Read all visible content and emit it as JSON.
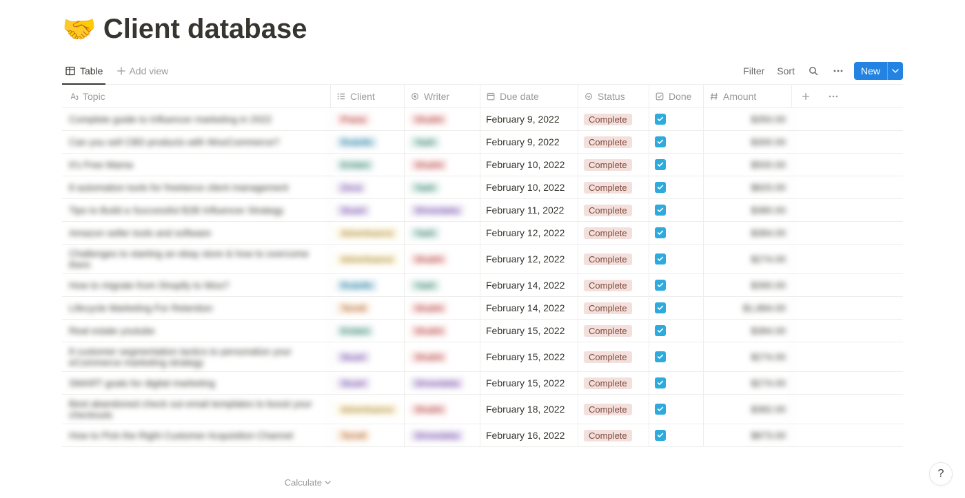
{
  "page": {
    "emoji": "🤝",
    "title": "Client database"
  },
  "views": {
    "active": "Table",
    "add_view_label": "Add view"
  },
  "toolbar": {
    "filter": "Filter",
    "sort": "Sort",
    "new": "New"
  },
  "columns": {
    "topic": "Topic",
    "client": "Client",
    "writer": "Writer",
    "due_date": "Due date",
    "status": "Status",
    "done": "Done",
    "amount": "Amount"
  },
  "rows": [
    {
      "topic": "Complete guide to Influencer marketing in 2022",
      "client": {
        "text": "Prana",
        "color": "red"
      },
      "writer": {
        "text": "Shubhi",
        "color": "red"
      },
      "date": "February 9, 2022",
      "status": "Complete",
      "done": true,
      "amount": "$350.00"
    },
    {
      "topic": "Can you sell CBD products with WooCommerce?",
      "client": {
        "text": "Rodolfo",
        "color": "blue"
      },
      "writer": {
        "text": "Yash",
        "color": "green"
      },
      "date": "February 9, 2022",
      "status": "Complete",
      "done": true,
      "amount": "$300.00"
    },
    {
      "topic": "It's Free Mama",
      "client": {
        "text": "Kristen",
        "color": "green"
      },
      "writer": {
        "text": "Shubhi",
        "color": "red"
      },
      "date": "February 10, 2022",
      "status": "Complete",
      "done": true,
      "amount": "$500.00"
    },
    {
      "topic": "8 automation tools for freelance client management",
      "client": {
        "text": "Zeca",
        "color": "purple"
      },
      "writer": {
        "text": "Yash",
        "color": "green"
      },
      "date": "February 10, 2022",
      "status": "Complete",
      "done": true,
      "amount": "$820.00"
    },
    {
      "topic": "Tips to Build a Successful B2B Influencer Strategy",
      "client": {
        "text": "Stuart",
        "color": "purple"
      },
      "writer": {
        "text": "Shreedatta",
        "color": "purple"
      },
      "date": "February 11, 2022",
      "status": "Complete",
      "done": true,
      "amount": "$380.00"
    },
    {
      "topic": "Amazon seller tools and software",
      "client": {
        "text": "Advertisance",
        "color": "yellow"
      },
      "writer": {
        "text": "Yash",
        "color": "green"
      },
      "date": "February 12, 2022",
      "status": "Complete",
      "done": true,
      "amount": "$384.00"
    },
    {
      "topic": "Challenges to starting an ebay store & how to overcome them",
      "client": {
        "text": "Advertisance",
        "color": "yellow"
      },
      "writer": {
        "text": "Shubhi",
        "color": "red"
      },
      "date": "February 12, 2022",
      "status": "Complete",
      "done": true,
      "amount": "$274.00"
    },
    {
      "topic": "How to migrate from Shopify to Woo?",
      "client": {
        "text": "Rodolfo",
        "color": "blue"
      },
      "writer": {
        "text": "Yash",
        "color": "green"
      },
      "date": "February 14, 2022",
      "status": "Complete",
      "done": true,
      "amount": "$390.00"
    },
    {
      "topic": "Lifecycle Marketing For Retention",
      "client": {
        "text": "Terrell",
        "color": "orange"
      },
      "writer": {
        "text": "Shubhi",
        "color": "red"
      },
      "date": "February 14, 2022",
      "status": "Complete",
      "done": true,
      "amount": "$1,884.00"
    },
    {
      "topic": "Real estate youtube",
      "client": {
        "text": "Kristen",
        "color": "green"
      },
      "writer": {
        "text": "Shubhi",
        "color": "red"
      },
      "date": "February 15, 2022",
      "status": "Complete",
      "done": true,
      "amount": "$384.00"
    },
    {
      "topic": "8 customer segmentation tactics to personalize your eCommerce marketing strategy",
      "client": {
        "text": "Stuart",
        "color": "purple"
      },
      "writer": {
        "text": "Shubhi",
        "color": "red"
      },
      "date": "February 15, 2022",
      "status": "Complete",
      "done": true,
      "amount": "$274.00"
    },
    {
      "topic": "SMART goals for digital marketing",
      "client": {
        "text": "Stuart",
        "color": "purple"
      },
      "writer": {
        "text": "Shreedatta",
        "color": "purple"
      },
      "date": "February 15, 2022",
      "status": "Complete",
      "done": true,
      "amount": "$274.00"
    },
    {
      "topic": "Best abandoned check out email templates to boost your checkouts",
      "client": {
        "text": "Advertisance",
        "color": "yellow"
      },
      "writer": {
        "text": "Shubhi",
        "color": "red"
      },
      "date": "February 18, 2022",
      "status": "Complete",
      "done": true,
      "amount": "$382.00"
    },
    {
      "topic": "How to Pick the Right Customer Acquisition Channel",
      "client": {
        "text": "Terrell",
        "color": "orange"
      },
      "writer": {
        "text": "Shreedatta",
        "color": "purple"
      },
      "date": "February 16, 2022",
      "status": "Complete",
      "done": true,
      "amount": "$873.00"
    }
  ],
  "footer": {
    "calculate": "Calculate"
  },
  "help": "?"
}
